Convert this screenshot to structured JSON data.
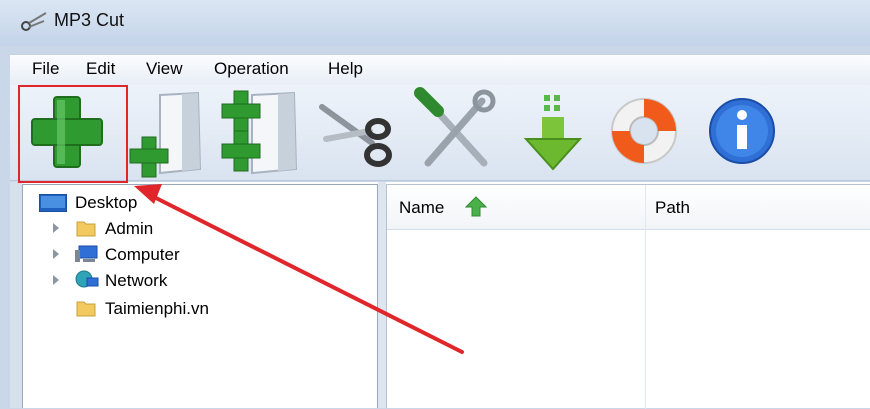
{
  "window": {
    "title": "MP3 Cut",
    "icon": "scissors-app-icon"
  },
  "menu": [
    {
      "label": "File"
    },
    {
      "label": "Edit"
    },
    {
      "label": "View"
    },
    {
      "label": "Operation"
    },
    {
      "label": "Help"
    }
  ],
  "toolbar": {
    "buttons": [
      {
        "icon": "add-file-icon"
      },
      {
        "icon": "add-to-list-icon"
      },
      {
        "icon": "add-multiple-icon"
      },
      {
        "icon": "cut-icon"
      },
      {
        "icon": "settings-tools-icon"
      },
      {
        "icon": "download-icon"
      },
      {
        "icon": "help-lifebuoy-icon"
      },
      {
        "icon": "info-icon"
      }
    ],
    "highlight_color": "#e0262a"
  },
  "tree": {
    "root": {
      "label": "Desktop",
      "icon": "desktop-icon"
    },
    "items": [
      {
        "label": "Admin",
        "icon": "folder-icon",
        "expandable": true
      },
      {
        "label": "Computer",
        "icon": "computer-icon",
        "expandable": true
      },
      {
        "label": "Network",
        "icon": "network-icon",
        "expandable": true
      },
      {
        "label": "Taimienphi.vn",
        "icon": "folder-icon",
        "expandable": false
      }
    ]
  },
  "list": {
    "columns": [
      {
        "label": "Name",
        "sort": "ascending"
      },
      {
        "label": "Path"
      }
    ],
    "rows": []
  },
  "annotation": {
    "color": "#e0262a",
    "description_icon": "red-arrow"
  }
}
